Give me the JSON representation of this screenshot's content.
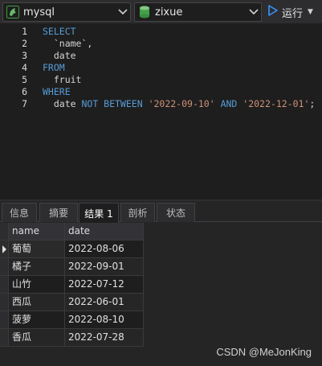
{
  "toolbar": {
    "connection": {
      "value": "mysql",
      "icon": "mysql-dolphin-icon"
    },
    "database": {
      "value": "zixue",
      "icon": "database-icon"
    },
    "run": {
      "label": "运行",
      "icon": "run-triangle-icon"
    }
  },
  "editor": {
    "lines": [
      {
        "num": "1",
        "tokens": [
          {
            "t": "SELECT",
            "c": "kw"
          }
        ]
      },
      {
        "num": "2",
        "tokens": [
          {
            "t": "  `name`,",
            "c": "plain"
          }
        ]
      },
      {
        "num": "3",
        "tokens": [
          {
            "t": "  date",
            "c": "plain"
          }
        ]
      },
      {
        "num": "4",
        "tokens": [
          {
            "t": "FROM",
            "c": "kw"
          }
        ]
      },
      {
        "num": "5",
        "tokens": [
          {
            "t": "  fruit",
            "c": "plain"
          }
        ]
      },
      {
        "num": "6",
        "tokens": [
          {
            "t": "WHERE",
            "c": "kw"
          }
        ]
      },
      {
        "num": "7",
        "tokens": [
          {
            "t": "  date ",
            "c": "plain"
          },
          {
            "t": "NOT BETWEEN ",
            "c": "kw"
          },
          {
            "t": "'2022-09-10'",
            "c": "str"
          },
          {
            "t": " AND ",
            "c": "kw"
          },
          {
            "t": "'2022-12-01'",
            "c": "str"
          },
          {
            "t": ";",
            "c": "plain"
          }
        ]
      }
    ]
  },
  "tabs": [
    {
      "label": "信息",
      "active": false
    },
    {
      "label": "摘要",
      "active": false
    },
    {
      "label": "结果 1",
      "active": true
    },
    {
      "label": "剖析",
      "active": false
    },
    {
      "label": "状态",
      "active": false
    }
  ],
  "results": {
    "columns": [
      "name",
      "date"
    ],
    "rows": [
      [
        "葡萄",
        "2022-08-06"
      ],
      [
        "橘子",
        "2022-09-01"
      ],
      [
        "山竹",
        "2022-07-12"
      ],
      [
        "西瓜",
        "2022-06-01"
      ],
      [
        "菠萝",
        "2022-08-10"
      ],
      [
        "香瓜",
        "2022-07-28"
      ]
    ]
  },
  "watermark": "CSDN @MeJonKing"
}
